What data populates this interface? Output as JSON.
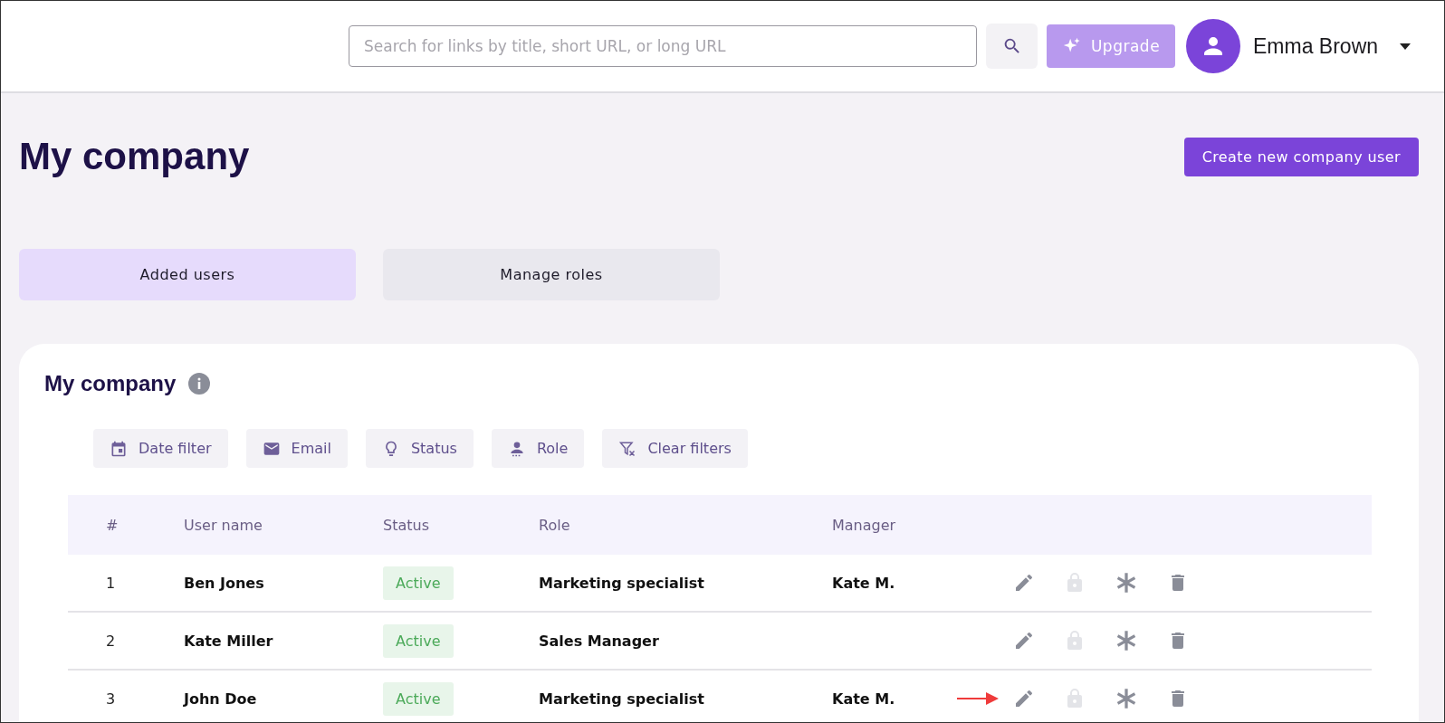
{
  "header": {
    "search": {
      "placeholder": "Search for links by title, short URL, or long URL"
    },
    "upgrade": "Upgrade",
    "user": "Emma Brown"
  },
  "page": {
    "title": "My company",
    "create_button": "Create new company user"
  },
  "tabs": [
    {
      "label": "Added users",
      "selected": true
    },
    {
      "label": "Manage roles",
      "selected": false
    }
  ],
  "card": {
    "title": "My company",
    "filters": [
      {
        "label": "Date filter",
        "kind": "calendar"
      },
      {
        "label": "Email",
        "kind": "mail"
      },
      {
        "label": "Status",
        "kind": "bulb"
      },
      {
        "label": "Role",
        "kind": "person"
      },
      {
        "label": "Clear filters",
        "kind": "clear"
      }
    ],
    "table": {
      "columns": [
        "#",
        "User name",
        "Status",
        "Role",
        "Manager"
      ],
      "rows": [
        {
          "n": "1",
          "name": "Ben Jones",
          "status": "Active",
          "role": "Marketing specialist",
          "manager": "Kate M.",
          "lock_disabled": true,
          "arrow": false
        },
        {
          "n": "2",
          "name": "Kate Miller",
          "status": "Active",
          "role": "Sales Manager",
          "lock_disabled": true,
          "arrow": false
        },
        {
          "n": "3",
          "name": "John Doe",
          "status": "Active",
          "role": "Marketing specialist",
          "manager": "Kate M.",
          "lock_disabled": true,
          "arrow": true
        }
      ]
    }
  }
}
